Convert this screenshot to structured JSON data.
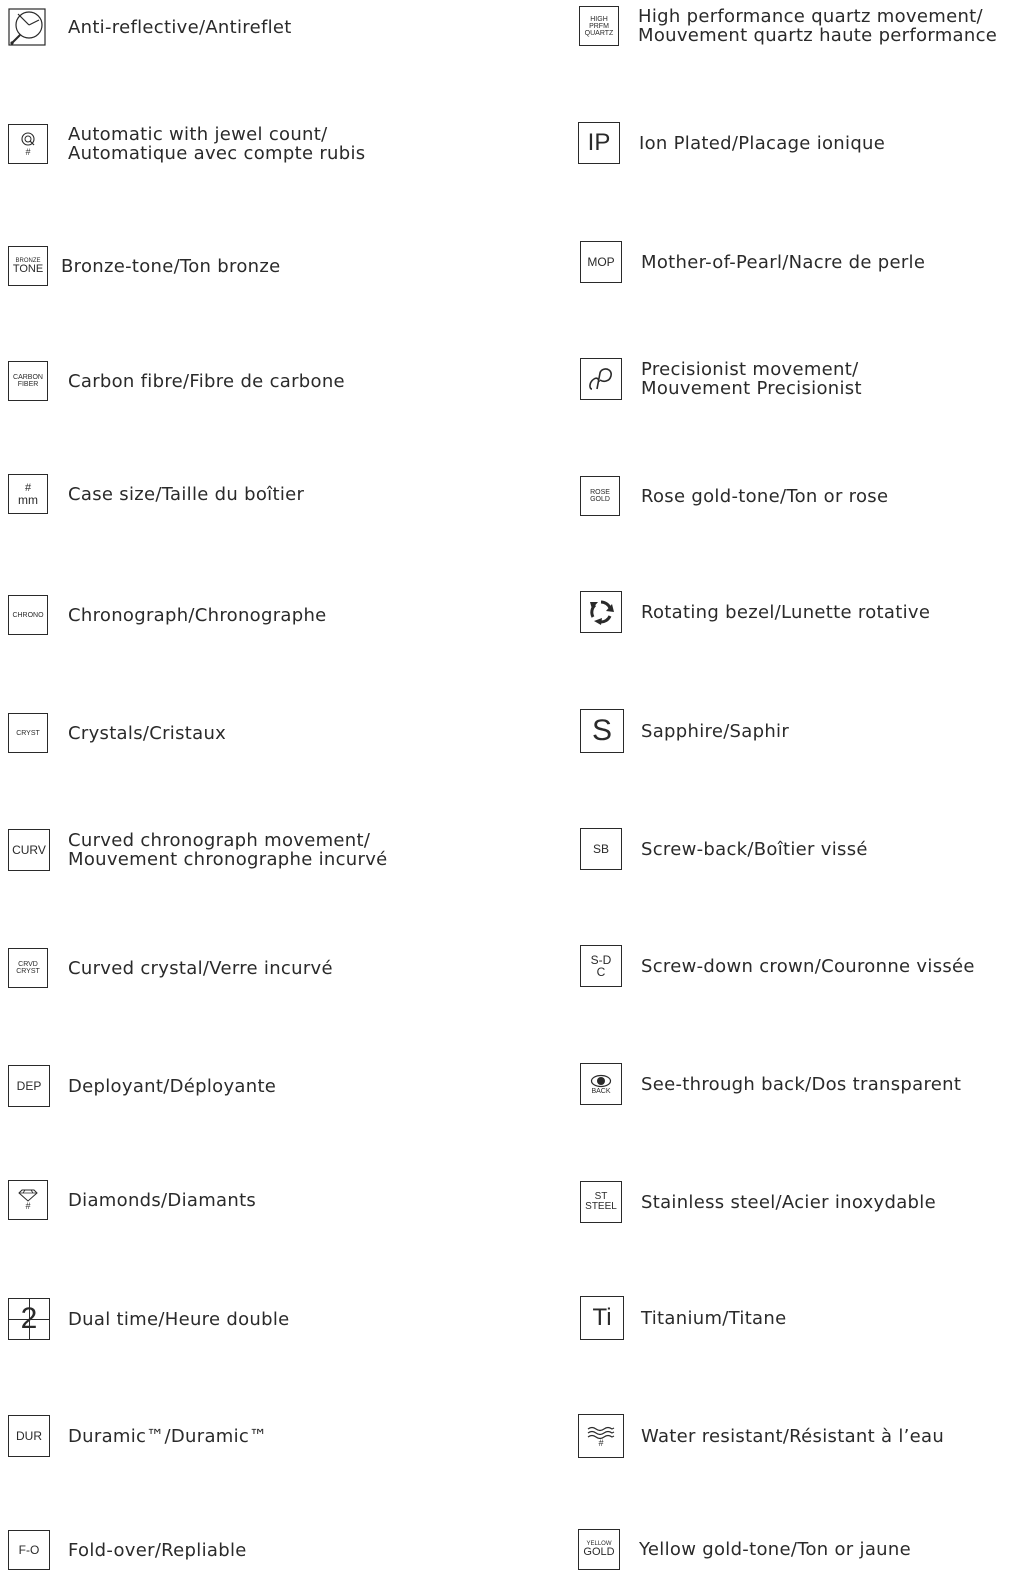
{
  "legend": {
    "left": [
      {
        "icon": "antireflective-icon",
        "lines": [
          "Anti-reflective/Antireflet"
        ]
      },
      {
        "icon": "automatic-jewel-icon",
        "icon_text": [
          "#"
        ],
        "lines": [
          "Automatic with jewel count/",
          "Automatique avec compte rubis"
        ]
      },
      {
        "icon": "bronze-tone-icon",
        "icon_text": [
          "BRONZE",
          "TONE"
        ],
        "lines": [
          "Bronze-tone/Ton bronze"
        ]
      },
      {
        "icon": "carbon-fiber-icon",
        "icon_text": [
          "CARBON",
          "FIBER"
        ],
        "lines": [
          "Carbon fibre/Fibre de carbone"
        ]
      },
      {
        "icon": "case-size-icon",
        "icon_text": [
          "#",
          "mm"
        ],
        "lines": [
          "Case size/Taille du boîtier"
        ]
      },
      {
        "icon": "chrono-icon",
        "icon_text": [
          "CHRONO"
        ],
        "lines": [
          "Chronograph/Chronographe"
        ]
      },
      {
        "icon": "crystals-icon",
        "icon_text": [
          "CRYST"
        ],
        "lines": [
          "Crystals/Cristaux"
        ]
      },
      {
        "icon": "curved-chrono-icon",
        "icon_text": [
          "CURV"
        ],
        "lines": [
          "Curved chronograph movement/",
          "Mouvement chronographe incurvé"
        ]
      },
      {
        "icon": "curved-crystal-icon",
        "icon_text": [
          "CRVD",
          "CRYST"
        ],
        "lines": [
          "Curved crystal/Verre incurvé"
        ]
      },
      {
        "icon": "deployant-icon",
        "icon_text": [
          "DEP"
        ],
        "lines": [
          "Deployant/Déployante"
        ]
      },
      {
        "icon": "diamonds-icon",
        "icon_text": [
          "#"
        ],
        "lines": [
          "Diamonds/Diamants"
        ]
      },
      {
        "icon": "dual-time-icon",
        "icon_text": [
          "2"
        ],
        "lines": [
          "Dual time/Heure double"
        ]
      },
      {
        "icon": "duramic-icon",
        "icon_text": [
          "DUR"
        ],
        "lines": [
          "Duramic™/Duramic™"
        ]
      },
      {
        "icon": "fold-over-icon",
        "icon_text": [
          "F-O"
        ],
        "lines": [
          "Fold-over/Repliable"
        ]
      }
    ],
    "right": [
      {
        "icon": "high-performance-quartz-icon",
        "icon_text": [
          "HIGH",
          "PRFM",
          "QUARTZ"
        ],
        "lines": [
          "High performance quartz movement/",
          "Mouvement quartz haute performance"
        ]
      },
      {
        "icon": "ion-plated-icon",
        "icon_text": [
          "IP"
        ],
        "lines": [
          "Ion Plated/Placage ionique"
        ]
      },
      {
        "icon": "mother-of-pearl-icon",
        "icon_text": [
          "MOP"
        ],
        "lines": [
          "Mother-of-Pearl/Nacre de perle"
        ]
      },
      {
        "icon": "precisionist-icon",
        "lines": [
          "Precisionist movement/",
          "Mouvement Precisionist"
        ]
      },
      {
        "icon": "rose-gold-icon",
        "icon_text": [
          "ROSE",
          "GOLD"
        ],
        "lines": [
          "Rose gold-tone/Ton or rose"
        ]
      },
      {
        "icon": "rotating-bezel-icon",
        "lines": [
          "Rotating bezel/Lunette rotative"
        ]
      },
      {
        "icon": "sapphire-icon",
        "icon_text": [
          "S"
        ],
        "lines": [
          "Sapphire/Saphir"
        ]
      },
      {
        "icon": "screw-back-icon",
        "icon_text": [
          "SB"
        ],
        "lines": [
          "Screw-back/Boîtier vissé"
        ]
      },
      {
        "icon": "screw-down-crown-icon",
        "icon_text": [
          "S-D",
          "C"
        ],
        "lines": [
          "Screw-down crown/Couronne vissée"
        ]
      },
      {
        "icon": "see-through-back-icon",
        "icon_text": [
          "BACK"
        ],
        "lines": [
          "See-through back/Dos transparent"
        ]
      },
      {
        "icon": "stainless-steel-icon",
        "icon_text": [
          "ST",
          "STEEL"
        ],
        "lines": [
          "Stainless steel/Acier inoxydable"
        ]
      },
      {
        "icon": "titanium-icon",
        "icon_text": [
          "Ti"
        ],
        "lines": [
          "Titanium/Titane"
        ]
      },
      {
        "icon": "water-resistant-icon",
        "icon_text": [
          "#"
        ],
        "lines": [
          "Water resistant/Résistant à l’eau"
        ]
      },
      {
        "icon": "yellow-gold-icon",
        "icon_text": [
          "YELLOW",
          "GOLD"
        ],
        "lines": [
          "Yellow gold-tone/Ton or jaune"
        ]
      }
    ]
  }
}
